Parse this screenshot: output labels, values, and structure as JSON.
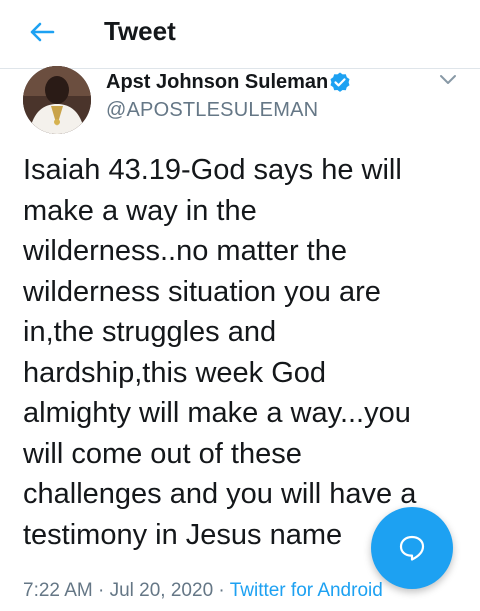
{
  "header": {
    "title": "Tweet",
    "back_icon": "arrow-left-icon"
  },
  "tweet": {
    "author_name": "Apst Johnson Suleman",
    "handle": "@APOSTLESULEMAN",
    "verified": true,
    "text": "Isaiah 43.19-God says he will\nmake a way in the\nwilderness..no matter the\nwilderness situation you are\nin,the struggles and\nhardship,this week God\nalmighty will make a way...you\nwill come out of these\nchallenges and you will have a\ntestimony in Jesus name",
    "time": "7:22 AM",
    "date": "Jul 20, 2020",
    "separator": "·",
    "source": "Twitter for Android"
  },
  "fab": {
    "icon": "reply-bubble-icon"
  },
  "colors": {
    "accent": "#1da1f2",
    "text_primary": "#14171a",
    "text_secondary": "#657786",
    "divider": "#dfe5ea"
  }
}
